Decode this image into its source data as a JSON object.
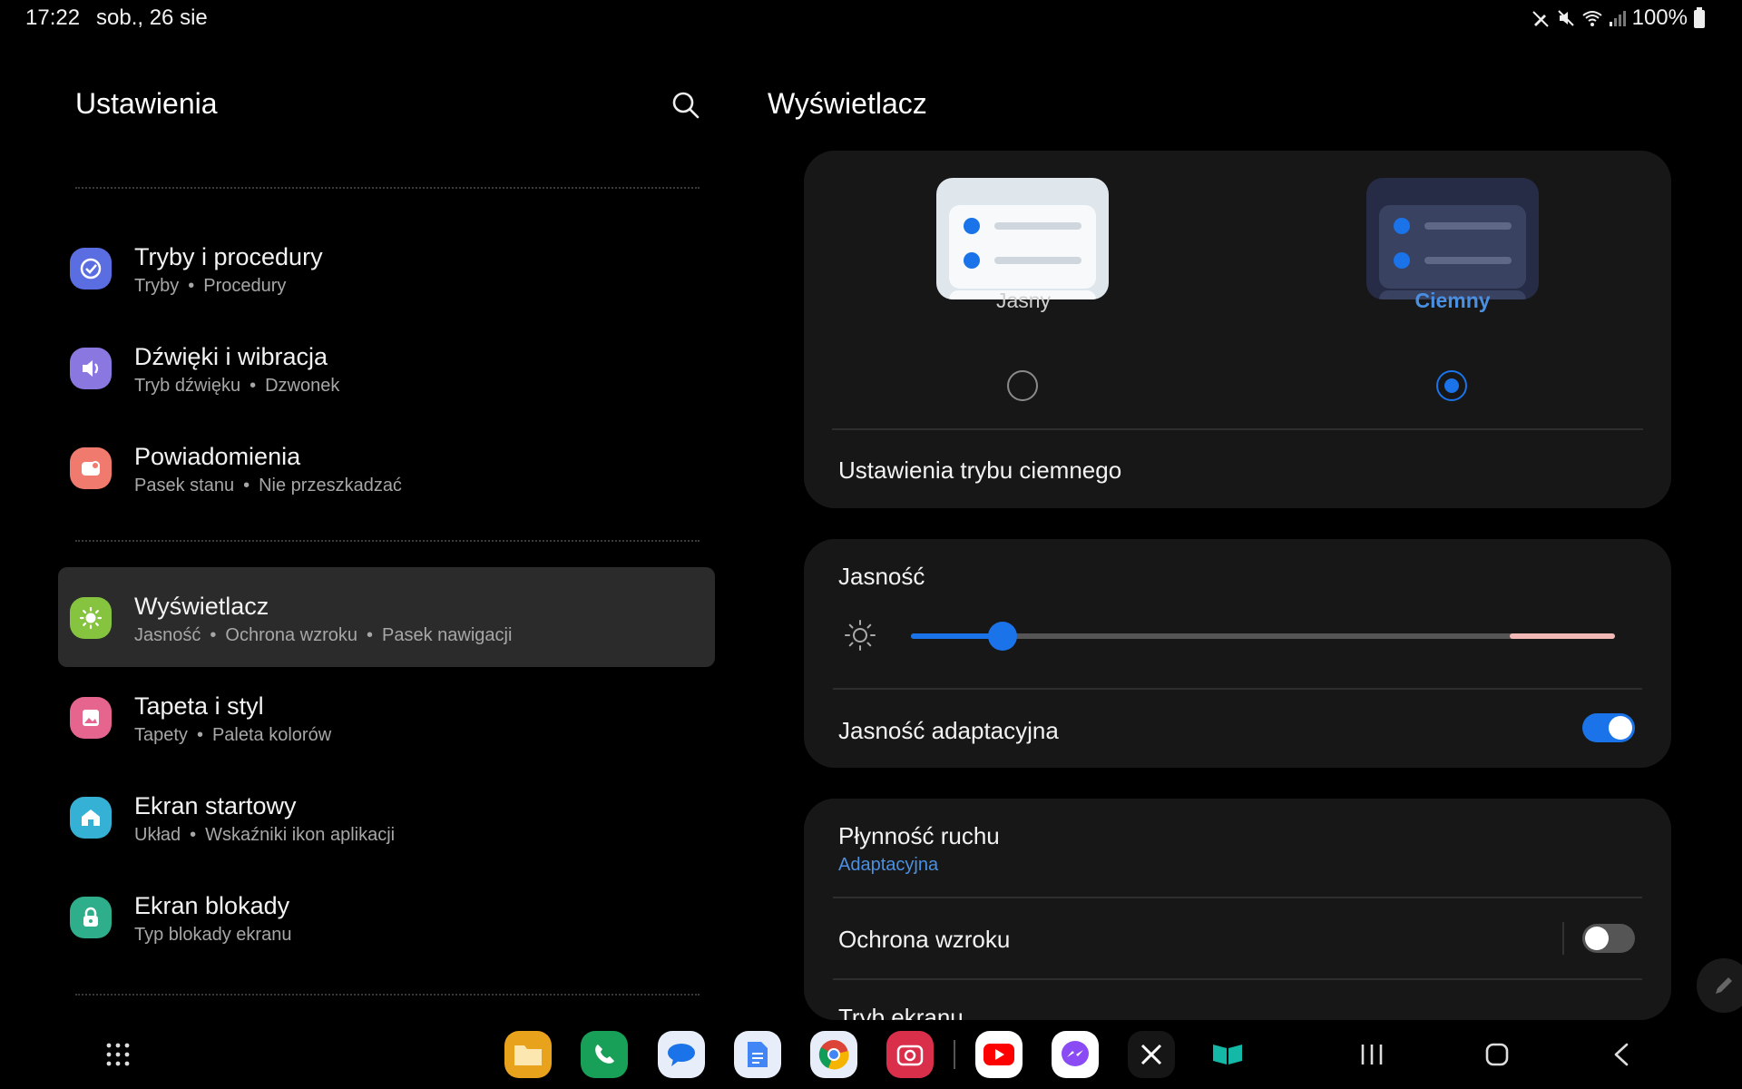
{
  "status_bar": {
    "time": "17:22",
    "date": "sob., 26 sie",
    "battery": "100%",
    "icons": [
      "pen-off-icon",
      "mute-icon",
      "wifi-icon",
      "signal-icon",
      "battery-icon"
    ]
  },
  "left": {
    "title": "Ustawienia",
    "search_icon": "search-icon",
    "items": [
      {
        "title": "Tryby i procedury",
        "subs": [
          "Tryby",
          "Procedury"
        ],
        "icon": "check-circle-icon",
        "color": "#5b6ee1"
      },
      {
        "title": "Dźwięki i wibracja",
        "subs": [
          "Tryb dźwięku",
          "Dzwonek"
        ],
        "icon": "speaker-icon",
        "color": "#8a78e0"
      },
      {
        "title": "Powiadomienia",
        "subs": [
          "Pasek stanu",
          "Nie przeszkadzać"
        ],
        "icon": "notification-icon",
        "color": "#ef7a6d"
      },
      {
        "title": "Wyświetlacz",
        "subs": [
          "Jasność",
          "Ochrona wzroku",
          "Pasek nawigacji"
        ],
        "icon": "sun-icon",
        "color": "#86c440",
        "active": true
      },
      {
        "title": "Tapeta i styl",
        "subs": [
          "Tapety",
          "Paleta kolorów"
        ],
        "icon": "picture-icon",
        "color": "#e6658f"
      },
      {
        "title": "Ekran startowy",
        "subs": [
          "Układ",
          "Wskaźniki ikon aplikacji"
        ],
        "icon": "home-icon",
        "color": "#35b1d6"
      },
      {
        "title": "Ekran blokady",
        "subs": [
          "Typ blokady ekranu"
        ],
        "icon": "lock-icon",
        "color": "#2eae8b"
      }
    ]
  },
  "right": {
    "title": "Wyświetlacz",
    "theme": {
      "light_label": "Jasny",
      "dark_label": "Ciemny",
      "selected": "dark",
      "dark_settings_label": "Ustawienia trybu ciemnego"
    },
    "brightness": {
      "label": "Jasność",
      "value": 0.13,
      "adaptive_label": "Jasność adaptacyjna",
      "adaptive_on": true
    },
    "motion": {
      "label": "Płynność ruchu",
      "value": "Adaptacyjna"
    },
    "eye_comfort": {
      "label": "Ochrona wzroku",
      "on": false
    },
    "screen_mode": {
      "label": "Tryb ekranu"
    }
  },
  "navbar": {
    "apps": [
      "files-icon",
      "phone-icon",
      "messages-icon",
      "docs-icon",
      "chrome-icon",
      "camera-icon",
      "youtube-icon",
      "messenger-icon",
      "x-icon",
      "reader-icon"
    ],
    "buttons": [
      "recents-button",
      "home-button",
      "back-button"
    ]
  },
  "colors": {
    "accent": "#1a73e8",
    "background": "#000000",
    "card": "#171717",
    "active_item": "#2b2b2b"
  }
}
